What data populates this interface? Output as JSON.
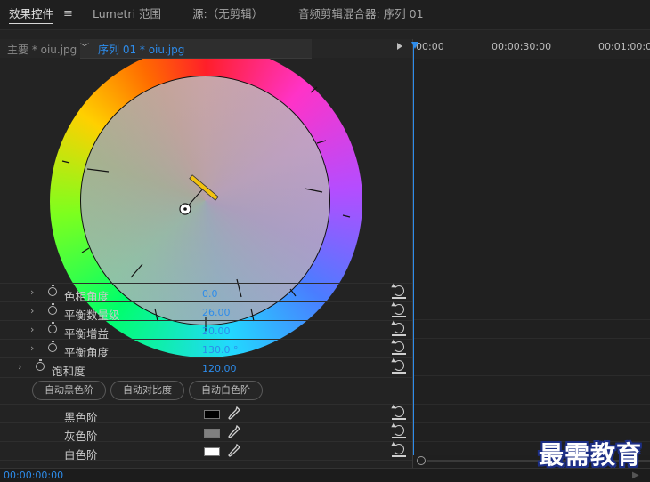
{
  "tabs": [
    {
      "label": "效果控件",
      "active": true
    },
    {
      "label": "Lumetri 范围",
      "active": false
    },
    {
      "label": "源:（无剪辑）",
      "active": false
    },
    {
      "label": "音频剪辑混合器: 序列 01",
      "active": false
    }
  ],
  "menu_icon": "hamburger-icon",
  "effect_controls": {
    "master_clip": "主要 * oiu.jpg",
    "sequence_clip": "序列 01 * oiu.jpg"
  },
  "params": [
    {
      "label": "色相角度",
      "value": "0.0"
    },
    {
      "label": "平衡数量级",
      "value": "26.00"
    },
    {
      "label": "平衡增益",
      "value": "20.00"
    },
    {
      "label": "平衡角度",
      "value": "130.0 °"
    },
    {
      "label": "饱和度",
      "value": "120.00"
    }
  ],
  "auto_buttons": [
    "自动黑色阶",
    "自动对比度",
    "自动白色阶"
  ],
  "levels": [
    {
      "label": "黑色阶",
      "color": "#000000"
    },
    {
      "label": "灰色阶",
      "color": "#808080"
    },
    {
      "label": "白色阶",
      "color": "#ffffff"
    }
  ],
  "timeline": {
    "ticks": [
      "00:00",
      "00:00:30:00",
      "00:01:00:0"
    ]
  },
  "footer": {
    "timecode": "00:00:00:00"
  },
  "watermark": "最需教育",
  "colors": {
    "accent": "#2d8ceb",
    "panel": "#232323",
    "watermark_outline": "#1d2f86"
  }
}
